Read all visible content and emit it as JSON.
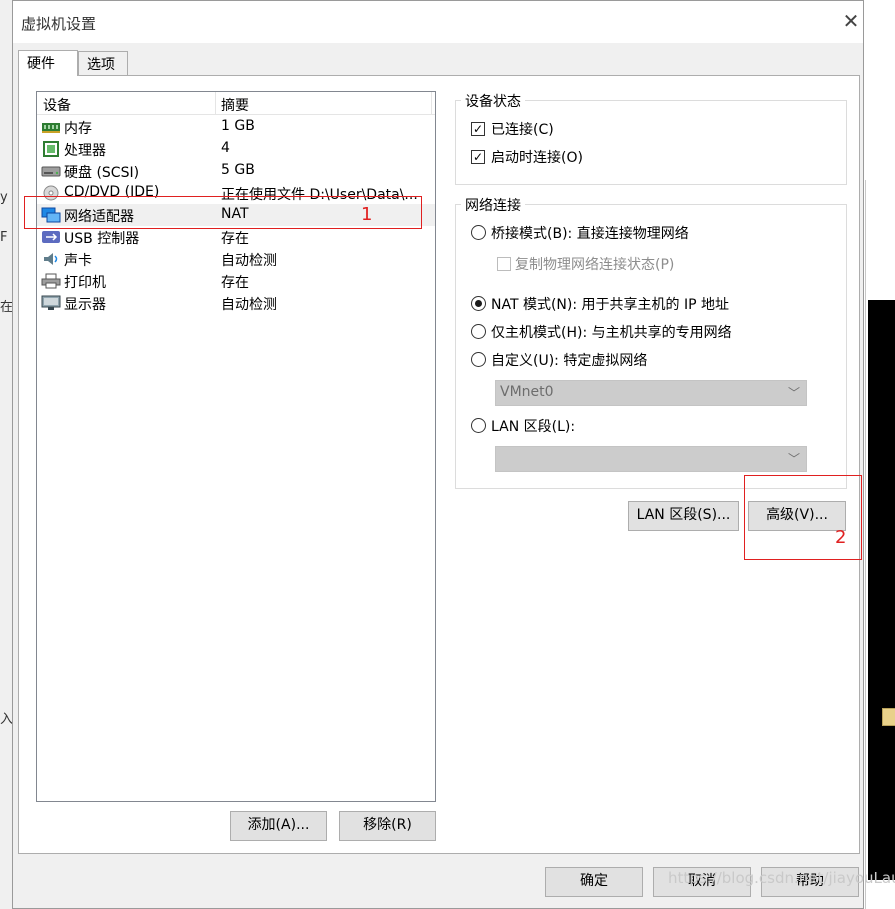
{
  "window": {
    "title": "虚拟机设置"
  },
  "tabs": [
    {
      "label": "硬件"
    },
    {
      "label": "选项"
    }
  ],
  "device_list": {
    "columns": [
      "设备",
      "摘要"
    ],
    "rows": [
      {
        "icon": "memory-icon",
        "name": "内存",
        "summary": "1 GB"
      },
      {
        "icon": "processor-icon",
        "name": "处理器",
        "summary": "4"
      },
      {
        "icon": "hard-disk-icon",
        "name": "硬盘 (SCSI)",
        "summary": "5 GB"
      },
      {
        "icon": "cd-dvd-icon",
        "name": "CD/DVD (IDE)",
        "summary": "正在使用文件 D:\\User\\Data\\..."
      },
      {
        "icon": "network-adapter-icon",
        "name": "网络适配器",
        "summary": "NAT"
      },
      {
        "icon": "usb-icon",
        "name": "USB 控制器",
        "summary": "存在"
      },
      {
        "icon": "sound-card-icon",
        "name": "声卡",
        "summary": "自动检测"
      },
      {
        "icon": "printer-icon",
        "name": "打印机",
        "summary": "存在"
      },
      {
        "icon": "display-icon",
        "name": "显示器",
        "summary": "自动检测"
      }
    ],
    "add_button": "添加(A)...",
    "remove_button": "移除(R)"
  },
  "device_status": {
    "title": "设备状态",
    "connected": {
      "label": "已连接(C)",
      "checked": true
    },
    "connect_at_power_on": {
      "label": "启动时连接(O)",
      "checked": true
    }
  },
  "network_connection": {
    "title": "网络连接",
    "bridged": {
      "label": "桥接模式(B): 直接连接物理网络",
      "selected": false
    },
    "replicate": {
      "label": "复制物理网络连接状态(P)",
      "checked": false
    },
    "nat": {
      "label": "NAT 模式(N): 用于共享主机的 IP 地址",
      "selected": true
    },
    "host_only": {
      "label": "仅主机模式(H): 与主机共享的专用网络",
      "selected": false
    },
    "custom": {
      "label": "自定义(U): 特定虚拟网络",
      "selected": false
    },
    "custom_select_value": "VMnet0",
    "lan_segment": {
      "label": "LAN 区段(L):",
      "selected": false
    },
    "lan_select_value": ""
  },
  "buttons": {
    "lan_segments": "LAN 区段(S)...",
    "advanced": "高级(V)...",
    "ok": "确定",
    "cancel": "取消",
    "help": "帮助"
  },
  "annotations": {
    "first": "1",
    "second": "2"
  },
  "watermark": "https://blog.csdn.net/jiayouLau",
  "background_fragments": [
    "y",
    "F",
    "在",
    "入"
  ],
  "colors": {
    "annotation_red": "#e02020",
    "selected_row": "#f0f0f0"
  }
}
